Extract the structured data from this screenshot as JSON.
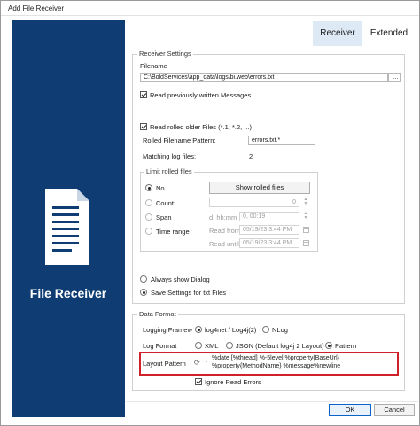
{
  "window": {
    "title": "Add File Receiver"
  },
  "sidebar": {
    "title": "File Receiver",
    "icon": "document-icon"
  },
  "tabs": [
    {
      "label": "Receiver",
      "selected": true
    },
    {
      "label": "Extended",
      "selected": false
    }
  ],
  "receiver_settings": {
    "legend": "Receiver Settings",
    "filename_label": "Filename",
    "filename_value": "C:\\BoldServices\\app_data\\logs\\bi.web\\errors.txt",
    "browse_label": "...",
    "read_previous_label": "Read previously written Messages",
    "read_previous_checked": true,
    "read_rolled_label": "Read rolled older Files (*.1, *.2, ...)",
    "read_rolled_checked": true,
    "rolled_pattern_label": "Rolled Filename Pattern:",
    "rolled_pattern_value": "errors.txt.*",
    "matching_label": "Matching log files:",
    "matching_value": "2",
    "limit": {
      "legend": "Limit rolled files",
      "no_label": "No",
      "show_rolled_label": "Show rolled files",
      "count_label": "Count:",
      "count_value": "0",
      "span_label": "Span",
      "span_hint": "d, hh:mm",
      "span_value": "0, 00:19",
      "time_range_label": "Time range",
      "read_from_label": "Read from",
      "read_from_value": "05/19/23 3:44 PM",
      "read_until_label": "Read until",
      "read_until_value": "05/19/23 3:44 PM",
      "selected": "No"
    },
    "always_show_label": "Always show Dialog",
    "save_settings_label": "Save Settings for txt Files",
    "dialog_choice": "save"
  },
  "data_format": {
    "legend": "Data Format",
    "framework_label": "Logging Framew",
    "framework_options": [
      "log4net / Log4j(2)",
      "NLog"
    ],
    "framework_selected": "log4net / Log4j(2)",
    "log_format_label": "Log Format",
    "log_format_options": [
      "XML",
      "JSON (Default log4j 2 Layout)",
      "Pattern"
    ],
    "log_format_selected": "Pattern",
    "layout_pattern_label": "Layout Pattern",
    "layout_pattern_value": "%date     [%thread]                %-5level %property{BaseUrl} %property{MethodName} %message%newline",
    "ignore_errors_label": "Ignore Read Errors",
    "ignore_errors_checked": true
  },
  "footer": {
    "ok_label": "OK",
    "cancel_label": "Cancel"
  },
  "colors": {
    "sidebar": "#0f3d73",
    "selected_tab": "#dde9f5",
    "highlight": "#d0202a"
  }
}
